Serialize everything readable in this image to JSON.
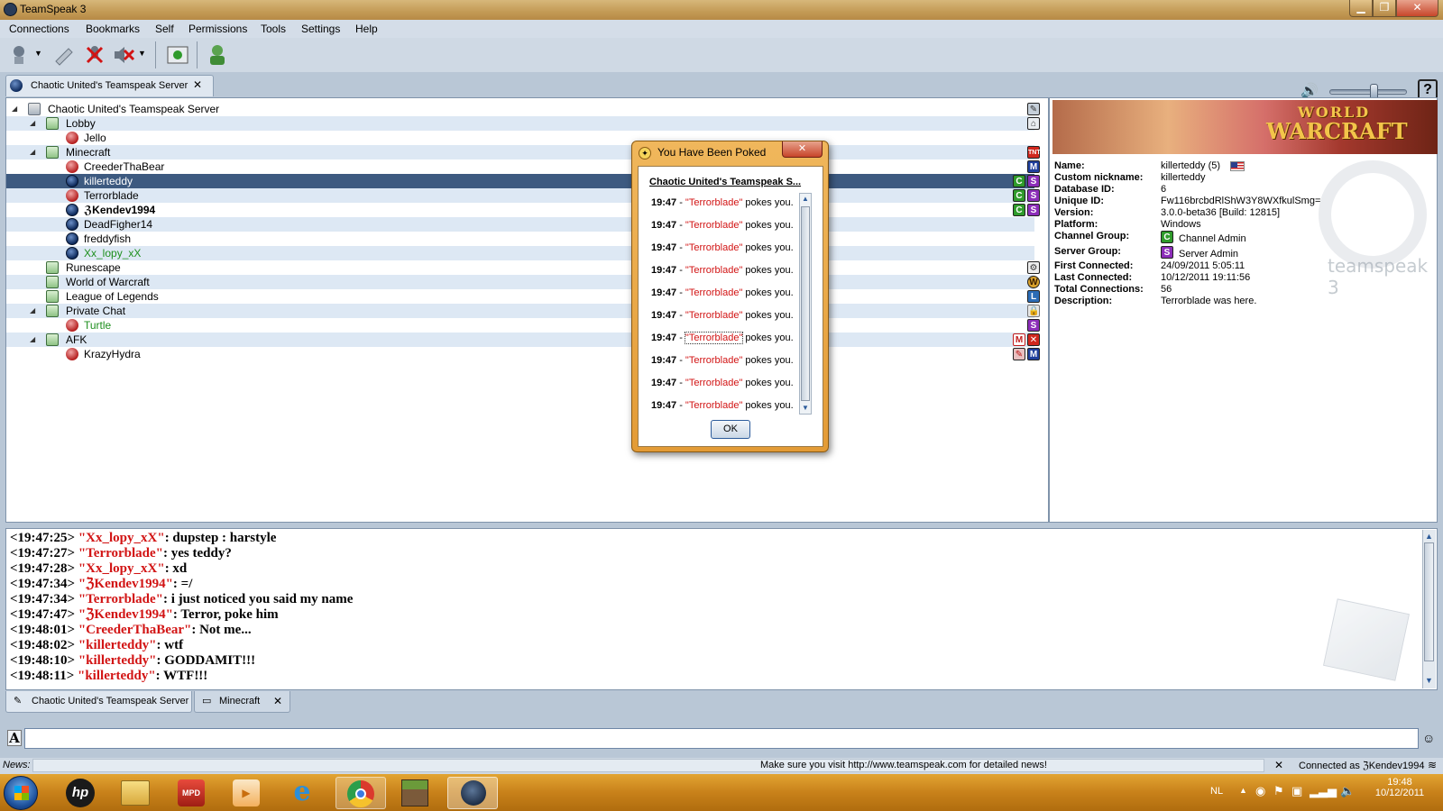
{
  "window": {
    "title": "TeamSpeak 3"
  },
  "menu": [
    "Connections",
    "Bookmarks",
    "Self",
    "Permissions",
    "Tools",
    "Settings",
    "Help"
  ],
  "server_tab": {
    "label": "Chaotic United's Teamspeak Server",
    "close": "✕"
  },
  "tree": {
    "server": "Chaotic United's Teamspeak Server",
    "channels": {
      "lobby": "Lobby",
      "minecraft": "Minecraft",
      "runescape": "Runescape",
      "wow": "World of Warcraft",
      "lol": "League of Legends",
      "private": "Private Chat",
      "afk": "AFK"
    },
    "clients": {
      "jello": "Jello",
      "creeder": "CreederThaBear",
      "killerteddy": "killerteddy",
      "terrorblade": "Terrorblade",
      "kendev": "ℨKendev1994",
      "deadfigher": "DeadFigher14",
      "freddy": "freddyfish",
      "lopy": "Xx_lopy_xX",
      "turtle": "Turtle",
      "krazy": "KrazyHydra"
    },
    "badges": {
      "c": "C",
      "s": "S",
      "m": "M",
      "l": "L",
      "w": "W",
      "x": "✕"
    }
  },
  "info": {
    "labels": {
      "name": "Name:",
      "nick": "Custom nickname:",
      "dbid": "Database ID:",
      "uid": "Unique ID:",
      "version": "Version:",
      "platform": "Platform:",
      "cgroup": "Channel Group:",
      "sgroup": "Server Group:",
      "first": "First Connected:",
      "last": "Last Connected:",
      "total": "Total Connections:",
      "desc": "Description:"
    },
    "values": {
      "name": "killerteddy (5)",
      "nick": "killerteddy",
      "dbid": "6",
      "uid": "Fw116brcbdRlShW3Y8WXfkulSmg=",
      "version": "3.0.0-beta36 [Build: 12815]",
      "platform": "Windows",
      "cgroup": "Channel Admin",
      "sgroup": "Server Admin",
      "first": "24/09/2011 5:05:11",
      "last": "10/12/2011 19:11:56",
      "total": "56",
      "desc": "Terrorblade was here."
    },
    "banner": {
      "line1": "WORLD",
      "line2": "WARCRAFT"
    },
    "watermark": "teamspeak 3"
  },
  "dialog": {
    "title": "You Have Been Poked",
    "header": "Chaotic United's Teamspeak S...",
    "time": "19:47",
    "sep": " - ",
    "poker": "\"Terrorblade\"",
    "action": " pokes you.",
    "ok": "OK"
  },
  "chat": [
    {
      "time": "<19:47:25>",
      "name": "\"Xx_lopy_xX\"",
      "msg": ": dupstep : harstyle"
    },
    {
      "time": "<19:47:27>",
      "name": "\"Terrorblade\"",
      "msg": ": yes teddy?"
    },
    {
      "time": "<19:47:28>",
      "name": "\"Xx_lopy_xX\"",
      "msg": ": xd"
    },
    {
      "time": "<19:47:34>",
      "name": "\"ℨKendev1994\"",
      "msg": ": =/"
    },
    {
      "time": "<19:47:34>",
      "name": "\"Terrorblade\"",
      "msg": ": i just noticed you said my name"
    },
    {
      "time": "<19:47:47>",
      "name": "\"ℨKendev1994\"",
      "msg": ": Terror, poke him"
    },
    {
      "time": "<19:48:01>",
      "name": "\"CreederThaBear\"",
      "msg": ": Not me..."
    },
    {
      "time": "<19:48:02>",
      "name": "\"killerteddy\"",
      "msg": ": wtf"
    },
    {
      "time": "<19:48:10>",
      "name": "\"killerteddy\"",
      "msg": ": GODDAMIT!!!"
    },
    {
      "time": "<19:48:11>",
      "name": "\"killerteddy\"",
      "msg": ": WTF!!!"
    }
  ],
  "chat_tabs": [
    {
      "label": "Chaotic United's Teamspeak Server"
    },
    {
      "label": "Minecraft",
      "close": "✕"
    }
  ],
  "input": {
    "format_icon": "A"
  },
  "news": {
    "label": "News:",
    "text": "Make sure you visit http://www.teamspeak.com for detailed news!",
    "close": "✕",
    "status": "Connected as ℨKendev1994"
  },
  "taskbar": {
    "lang": "NL",
    "time": "19:48",
    "date": "10/12/2011",
    "hp": "hp",
    "mpd": "MPD"
  },
  "colors": {
    "accent": "#3d5a80",
    "poker_name": "#d21414",
    "taskbar": "#c8811a",
    "titlebar": "#c39a55"
  }
}
